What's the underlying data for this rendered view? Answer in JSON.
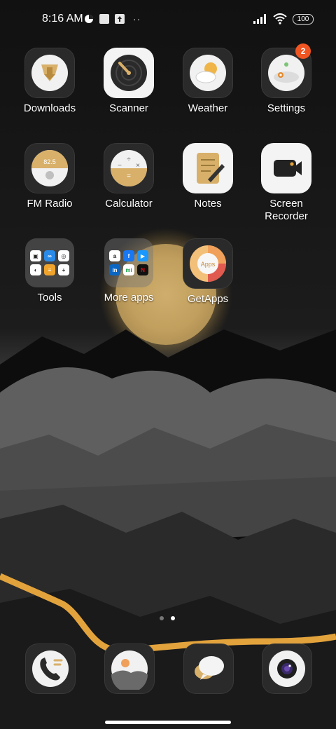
{
  "status_bar": {
    "time": "8:16 AM",
    "battery": "100"
  },
  "apps_row1": [
    {
      "label": "Downloads"
    },
    {
      "label": "Scanner"
    },
    {
      "label": "Weather"
    },
    {
      "label": "Settings",
      "badge": "2"
    }
  ],
  "apps_row2": [
    {
      "label": "FM Radio",
      "freq": "82.5"
    },
    {
      "label": "Calculator"
    },
    {
      "label": "Notes"
    },
    {
      "label": "Screen\nRecorder"
    }
  ],
  "apps_row3": [
    {
      "label": "Tools"
    },
    {
      "label": "More apps"
    },
    {
      "label": "GetApps",
      "icon_text": "Apps"
    }
  ],
  "dock": [
    "phone-icon",
    "gallery-icon",
    "messages-icon",
    "camera-icon"
  ],
  "pager": {
    "pages": 2,
    "active_page": 2
  }
}
